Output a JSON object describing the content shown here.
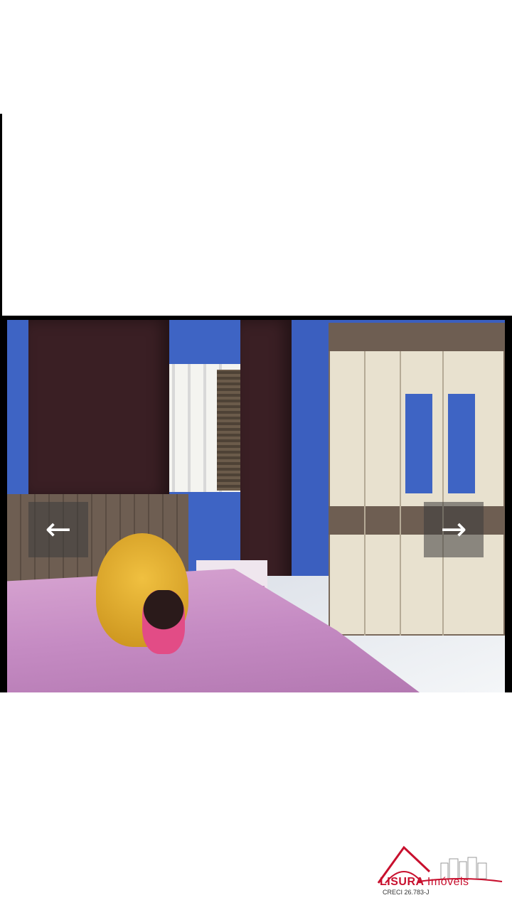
{
  "gallery": {
    "photo_alt": "Quarto",
    "prev_icon": "arrow-left-icon",
    "next_icon": "arrow-right-icon",
    "prev_glyph": "←",
    "next_glyph": "→"
  },
  "logo": {
    "brand_main": "LISURA",
    "brand_accent": "Imóveis",
    "creci": "CRECI 26.783-J",
    "color": "#c8102e"
  }
}
